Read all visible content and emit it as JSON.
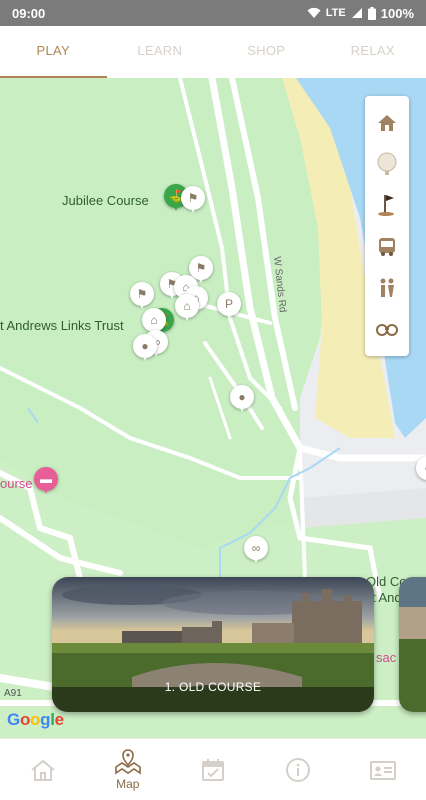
{
  "status_bar": {
    "time": "09:00",
    "network": "LTE",
    "battery": "100%"
  },
  "tabs": [
    {
      "label": "PLAY",
      "active": true
    },
    {
      "label": "LEARN",
      "active": false
    },
    {
      "label": "SHOP",
      "active": false
    },
    {
      "label": "RELAX",
      "active": false
    }
  ],
  "map": {
    "labels": {
      "jubilee": "Jubilee Course",
      "links_trust": "t Andrews Links Trust",
      "course_left": "ourse",
      "old_course_right": "Old Cou",
      "st_andrews_right": "t And",
      "sac_right": "sac",
      "road": "W Sands Rd",
      "a91": "A91"
    },
    "google_logo": [
      "G",
      "o",
      "o",
      "g",
      "l",
      "e"
    ],
    "side_panel_icons": [
      "home-icon",
      "golf-ball-icon",
      "flag-icon",
      "bus-icon",
      "restroom-icon",
      "binoculars-icon"
    ]
  },
  "cards": [
    {
      "title": "1. OLD COURSE"
    }
  ],
  "bottom_nav": [
    {
      "icon": "home-icon",
      "label": ""
    },
    {
      "icon": "map-icon",
      "label": "Map"
    },
    {
      "icon": "calendar-icon",
      "label": ""
    },
    {
      "icon": "info-icon",
      "label": ""
    },
    {
      "icon": "id-card-icon",
      "label": ""
    }
  ],
  "colors": {
    "accent": "#b08656",
    "map_green": "#c8eec2",
    "sea": "#a9d8f5",
    "sand": "#f4eeb6"
  }
}
